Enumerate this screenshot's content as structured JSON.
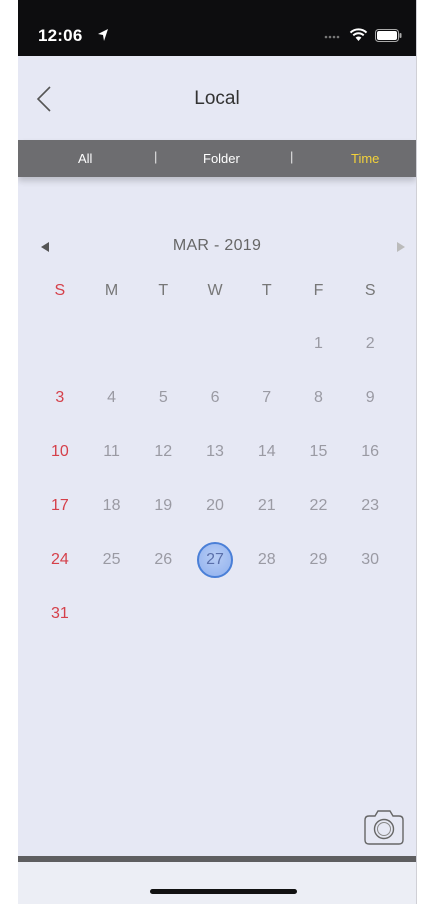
{
  "status_bar": {
    "time": "12:06",
    "icons": [
      "location-arrow-icon",
      "signal-dots-icon",
      "wifi-icon",
      "battery-icon"
    ]
  },
  "nav": {
    "title": "Local",
    "back_icon": "chevron-left-icon"
  },
  "tabs": {
    "items": [
      {
        "label": "All",
        "active": false
      },
      {
        "label": "Folder",
        "active": false
      },
      {
        "label": "Time",
        "active": true
      }
    ],
    "separator": "|",
    "active_color": "#f3d23a"
  },
  "calendar": {
    "month_label": "MAR - 2019",
    "weekdays": [
      "S",
      "M",
      "T",
      "W",
      "T",
      "F",
      "S"
    ],
    "weeks": [
      [
        "",
        "",
        "",
        "",
        "",
        "1",
        "2"
      ],
      [
        "3",
        "4",
        "5",
        "6",
        "7",
        "8",
        "9"
      ],
      [
        "10",
        "11",
        "12",
        "13",
        "14",
        "15",
        "16"
      ],
      [
        "17",
        "18",
        "19",
        "20",
        "21",
        "22",
        "23"
      ],
      [
        "24",
        "25",
        "26",
        "27",
        "28",
        "29",
        "30"
      ],
      [
        "31",
        "",
        "",
        "",
        "",
        "",
        ""
      ]
    ],
    "selected_day": "27",
    "sunday_color": "#d5404a",
    "prev_icon": "triangle-left-icon",
    "next_icon": "triangle-right-icon"
  },
  "camera": {
    "icon": "camera-icon"
  },
  "colors": {
    "background": "#e6e8f4",
    "tab_bar": "#6d6d70",
    "selected_circle": "#8fb0ee"
  }
}
